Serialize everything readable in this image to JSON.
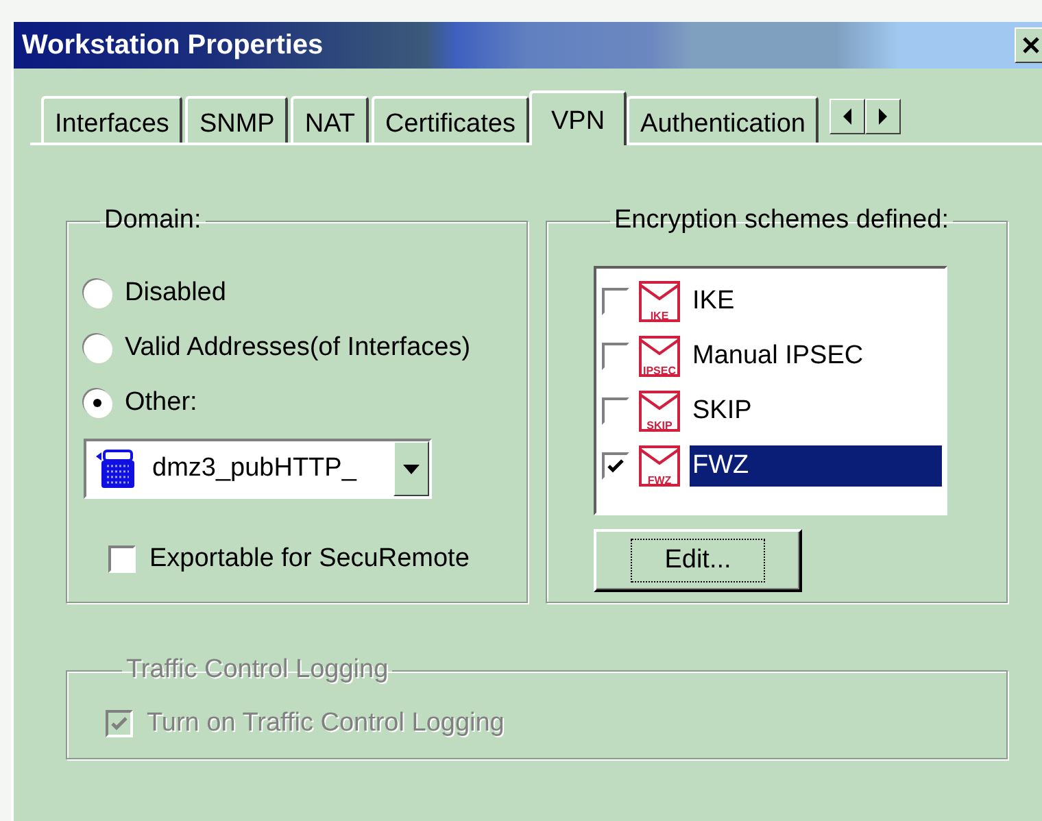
{
  "window": {
    "title": "Workstation Properties"
  },
  "tabs": [
    {
      "label": "Interfaces",
      "selected": false
    },
    {
      "label": "SNMP",
      "selected": false
    },
    {
      "label": "NAT",
      "selected": false
    },
    {
      "label": "Certificates",
      "selected": false
    },
    {
      "label": "VPN",
      "selected": true
    },
    {
      "label": "Authentication",
      "selected": false
    }
  ],
  "domain": {
    "title": "Domain:",
    "options": [
      {
        "label": "Disabled",
        "selected": false
      },
      {
        "label": "Valid Addresses(of Interfaces)",
        "selected": false
      },
      {
        "label": "Other:",
        "selected": true
      }
    ],
    "dropdown": {
      "value": "dmz3_pubHTTP_"
    },
    "exportable": {
      "label": "Exportable for SecuRemote",
      "checked": false
    }
  },
  "encryption": {
    "title": "Encryption schemes defined:",
    "schemes": [
      {
        "label": "IKE",
        "badge": "IKE",
        "checked": false,
        "selected": false
      },
      {
        "label": "Manual IPSEC",
        "badge": "IPSEC",
        "checked": false,
        "selected": false
      },
      {
        "label": "SKIP",
        "badge": "SKIP",
        "checked": false,
        "selected": false
      },
      {
        "label": "FWZ",
        "badge": "FWZ",
        "checked": true,
        "selected": true
      }
    ],
    "edit_button": "Edit..."
  },
  "traffic": {
    "title": "Traffic Control Logging",
    "disabled": true,
    "checkbox": {
      "label": "Turn on Traffic Control Logging",
      "checked": true
    }
  }
}
